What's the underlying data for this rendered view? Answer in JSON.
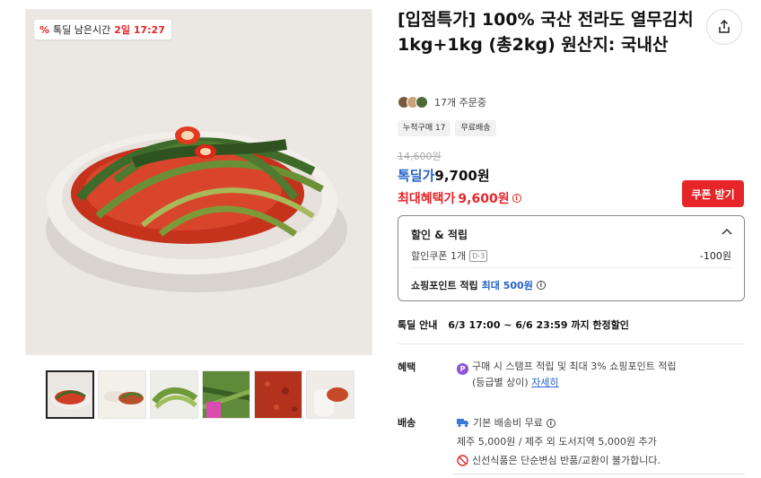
{
  "deal_badge": {
    "icon": "percent-icon",
    "label": "톡딜 남은시간",
    "time": "2일 17:27"
  },
  "product": {
    "title": "[입점특가] 100% 국산 전라도 열무김치 1kg+1kg (총2kg) 원산지: 국내산"
  },
  "orders": {
    "text": "17개 주문중"
  },
  "tags": [
    "누적구매 17",
    "무료배송"
  ],
  "price": {
    "original": "14,600원",
    "deal_label": "톡딜가",
    "deal_value": "9,700원",
    "max_label": "최대혜택가",
    "max_value": "9,600원"
  },
  "coupon_button": "쿠폰 받기",
  "discount": {
    "header": "할인 & 적립",
    "coupon_text": "할인쿠폰 1개",
    "coupon_badge": "D-3",
    "coupon_amount": "-100원",
    "points_label": "쇼핑포인트 적립",
    "points_value": "최대 500원"
  },
  "period": {
    "label": "톡딜 안내",
    "text": "6/3 17:00 ~ 6/6 23:59 까지 한정할인"
  },
  "benefit": {
    "label": "혜택",
    "line1": "구매 시 스탬프 적립 및 최대 3% 쇼핑포인트 적립",
    "line2": "(등급별 상이)",
    "link": "자세히"
  },
  "shipping": {
    "label": "배송",
    "line1": "기본 배송비 무료",
    "line2": "제주 5,000원 / 제주 외 도서지역 5,000원 추가",
    "line3": "신선식품은 단순변심 반품/교환이 불가합니다."
  },
  "colors": {
    "accent_red": "#e52528",
    "accent_blue": "#2563c9",
    "point_purple": "#8a55d9"
  }
}
